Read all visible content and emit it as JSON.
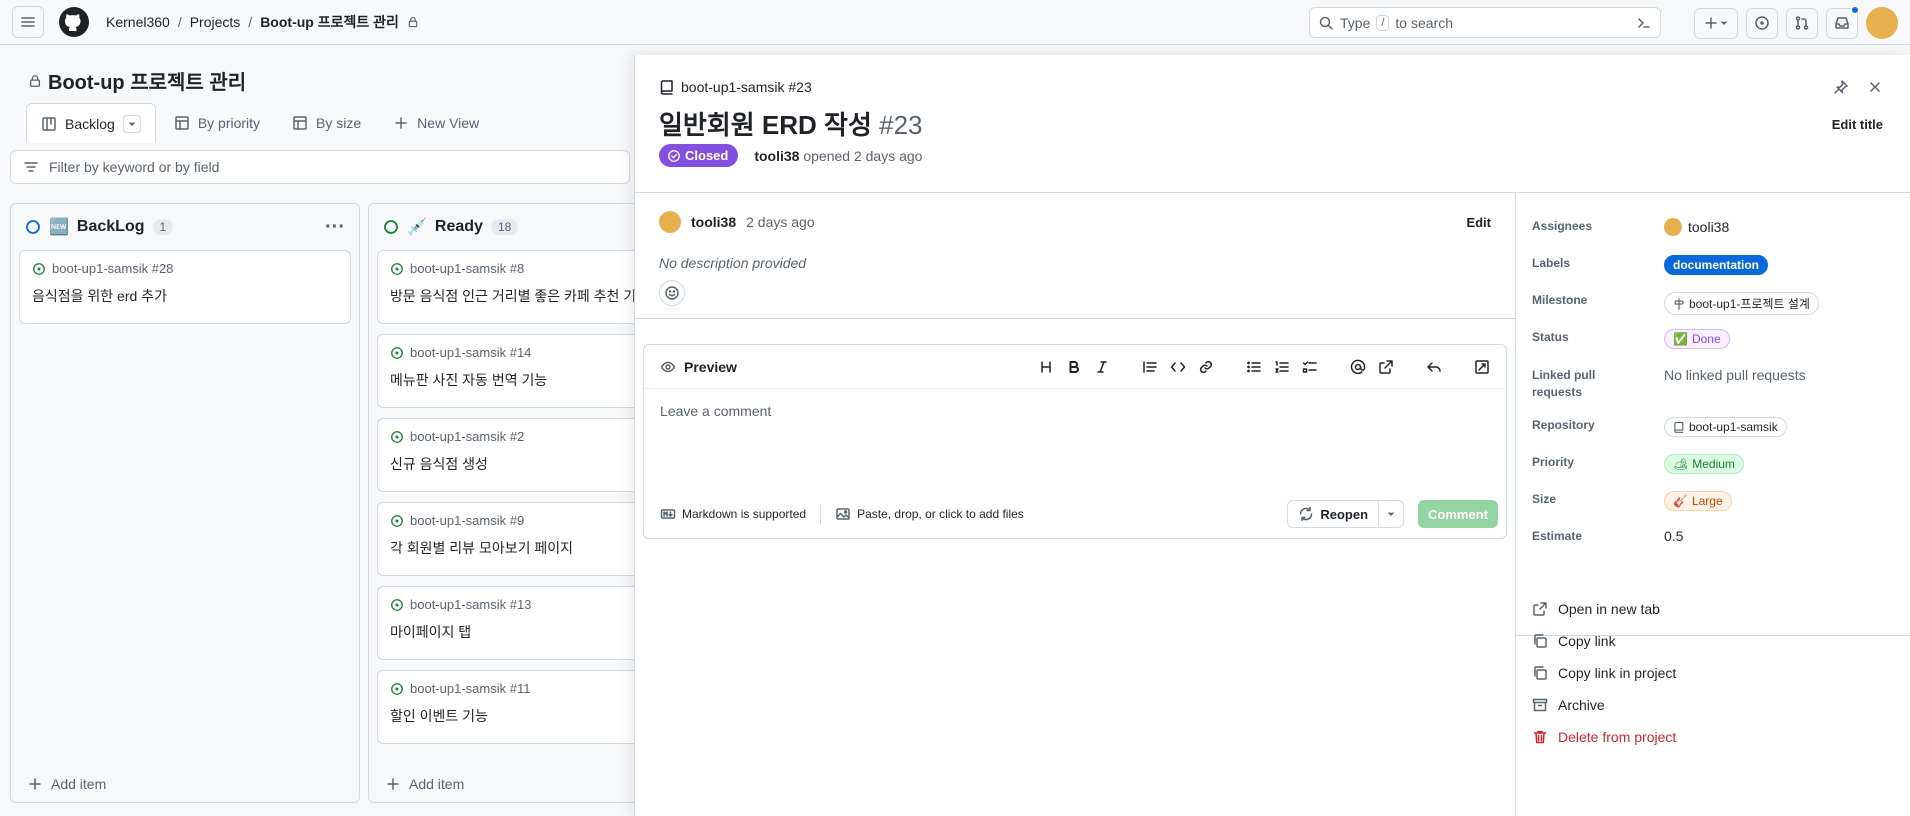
{
  "header": {
    "breadcrumbs": [
      "Kernel360",
      "Projects",
      "Boot-up 프로젝트 관리"
    ],
    "search_prefix": "Type",
    "search_key": "/",
    "search_suffix": "to search"
  },
  "project": {
    "title": "Boot-up 프로젝트 관리",
    "views": [
      "Backlog",
      "By priority",
      "By size"
    ],
    "new_view": "New View",
    "filter_placeholder": "Filter by keyword or by field"
  },
  "columns": [
    {
      "emoji": "🆕",
      "name": "BackLog",
      "count": "1",
      "status_color": "#0969da",
      "cards": [
        {
          "ref": "boot-up1-samsik #28",
          "title": "음식점을 위한 erd 추가"
        }
      ],
      "add_item": "Add item"
    },
    {
      "emoji": "💉",
      "name": "Ready",
      "count": "18",
      "status_color": "#1a7f37",
      "cards": [
        {
          "ref": "boot-up1-samsik #8",
          "title": "방문 음식점 인근 거리별 좋은 카페 추천 기능"
        },
        {
          "ref": "boot-up1-samsik #14",
          "title": "메뉴판 사진 자동 번역 기능"
        },
        {
          "ref": "boot-up1-samsik #2",
          "title": "신규 음식점 생성"
        },
        {
          "ref": "boot-up1-samsik #9",
          "title": "각 회원별 리뷰 모아보기 페이지"
        },
        {
          "ref": "boot-up1-samsik #13",
          "title": "마이페이지 탭"
        },
        {
          "ref": "boot-up1-samsik #11",
          "title": "할인 이벤트 기능"
        }
      ],
      "add_item": "Add item"
    }
  ],
  "issue": {
    "repo_ref": "boot-up1-samsik #23",
    "title": "일반회원 ERD 작성",
    "number": "#23",
    "state": "Closed",
    "state_color": "#8250df",
    "author": "tooli38",
    "opened": "opened 2 days ago",
    "edit_title": "Edit title",
    "comment": {
      "author": "tooli38",
      "time": "2 days ago",
      "edit": "Edit",
      "body": "No description provided"
    },
    "editor": {
      "tab": "Preview",
      "placeholder": "Leave a comment",
      "markdown": "Markdown is supported",
      "attach": "Paste, drop, or click to add files",
      "reopen": "Reopen",
      "comment": "Comment"
    }
  },
  "fields": {
    "assignees": {
      "label": "Assignees",
      "value": "tooli38"
    },
    "labels": {
      "label": "Labels",
      "value": "documentation",
      "color": "#0969da"
    },
    "milestone": {
      "label": "Milestone",
      "value": "boot-up1-프로젝트 설계"
    },
    "status": {
      "label": "Status",
      "value": "Done",
      "emoji": "✅",
      "color": "#8250df"
    },
    "linked": {
      "label_line1": "Linked pull",
      "label_line2": "requests",
      "value": "No linked pull requests"
    },
    "repository": {
      "label": "Repository",
      "value": "boot-up1-samsik"
    },
    "priority": {
      "label": "Priority",
      "value": "Medium",
      "emoji": "🏕",
      "color": "#1a7f37"
    },
    "size": {
      "label": "Size",
      "value": "Large",
      "emoji": "🎸",
      "color": "#bc4c00"
    },
    "estimate": {
      "label": "Estimate",
      "value": "0.5"
    }
  },
  "actions": {
    "open_tab": "Open in new tab",
    "copy_link": "Copy link",
    "copy_link_project": "Copy link in project",
    "archive": "Archive",
    "delete": "Delete from project"
  }
}
